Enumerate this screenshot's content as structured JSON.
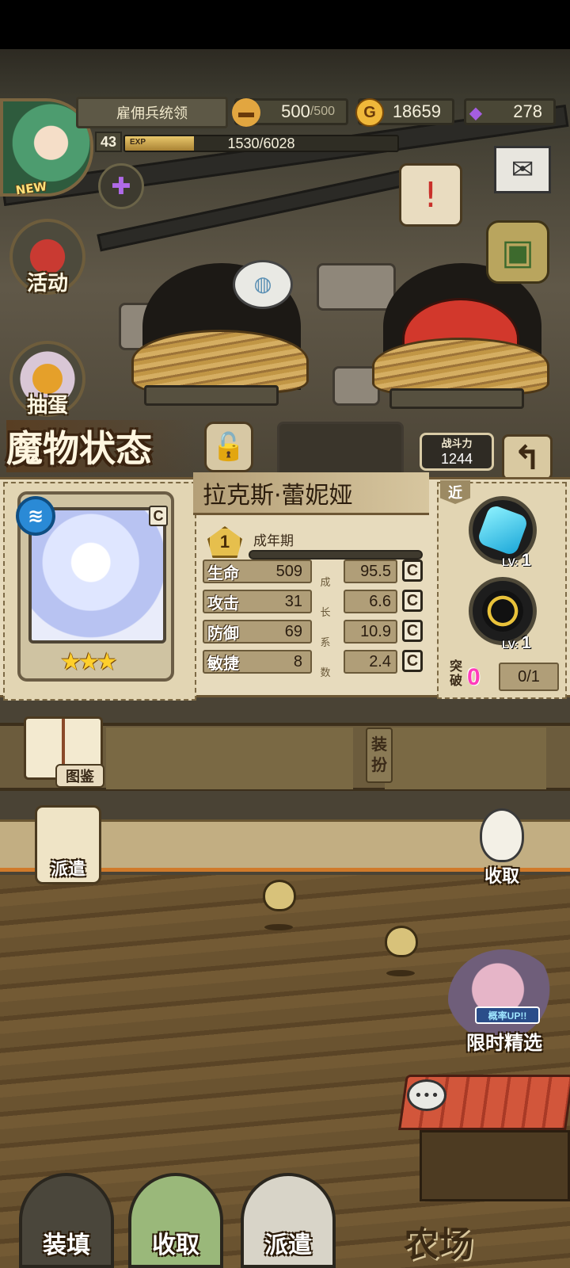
{
  "hud": {
    "avatar_badge": "NEW",
    "player_title": "雇佣兵统领",
    "level": "43",
    "exp_label": "EXP",
    "exp_text": "1530/6028",
    "exp_progress": 0.254,
    "food": {
      "icon": "bread-icon",
      "current": "500",
      "max": "/500"
    },
    "gold": {
      "icon": "gold-coin-icon",
      "glyph": "G",
      "value": "18659"
    },
    "gems": {
      "icon": "purple-gem-icon",
      "value": "278"
    }
  },
  "side_menu": {
    "event_label": "活动",
    "egg_hunt_label": "抽蛋"
  },
  "monster_panel": {
    "title": "魔物状态",
    "power_label": "战斗力",
    "power_value": "1244",
    "back_glyph": "↰",
    "name": "拉克斯·蕾妮娅",
    "rank_letter": "C",
    "element_glyph": "≋",
    "star_count": 3,
    "stars": "★★★",
    "stage_number": "1",
    "stage_label": "成年期",
    "stats": [
      {
        "name": "生命",
        "value": "509",
        "growth": "95.5",
        "grade": "C"
      },
      {
        "name": "攻击",
        "value": "31",
        "growth": "6.6",
        "grade": "C"
      },
      {
        "name": "防御",
        "value": "69",
        "growth": "10.9",
        "grade": "C"
      },
      {
        "name": "敏捷",
        "value": "8",
        "growth": "2.4",
        "grade": "C"
      }
    ],
    "growth_chars": [
      "成",
      "长",
      "系",
      "数"
    ],
    "range_tag": "近",
    "skills": [
      {
        "icon": "ice-crystal-icon",
        "lv_label": "LV:",
        "lv": "1"
      },
      {
        "icon": "light-orb-icon",
        "lv_label": "LV:",
        "lv": "1"
      }
    ],
    "break_label": "突破",
    "break_count": "0",
    "break_progress": "0/1"
  },
  "shelf": {
    "codex_label": "图鉴",
    "equip_label": "装扮"
  },
  "farm": {
    "dispatch_label": "派遣",
    "collect_label": "收取",
    "promo_tag": "概率UP!!",
    "promo_label": "限时精选",
    "farm_label": "农场",
    "chat_glyph": "•••"
  },
  "bottom_bar": {
    "load_label": "装填",
    "collect_label": "收取",
    "dispatch_label": "派遣"
  }
}
